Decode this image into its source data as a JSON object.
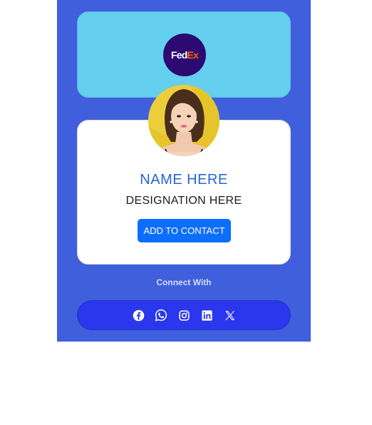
{
  "brand": {
    "logo_text_primary": "Fed",
    "logo_text_secondary": "Ex",
    "logo_bg_color": "#2d0a72",
    "logo_primary_color": "#ffffff",
    "logo_secondary_color": "#ff6600"
  },
  "profile": {
    "name": "NAME HERE",
    "designation": "DESIGNATION HERE",
    "add_contact_label": "ADD TO CONTACT"
  },
  "connect": {
    "label": "Connect With",
    "icons": [
      "facebook-icon",
      "whatsapp-icon",
      "instagram-icon",
      "linkedin-icon",
      "x-icon"
    ]
  },
  "colors": {
    "panel_bg": "#3f5fdc",
    "header_card_bg": "#64cfee",
    "name_color": "#2565d6",
    "button_bg": "#0d6efd",
    "social_bar_bg": "#2a37ec"
  }
}
